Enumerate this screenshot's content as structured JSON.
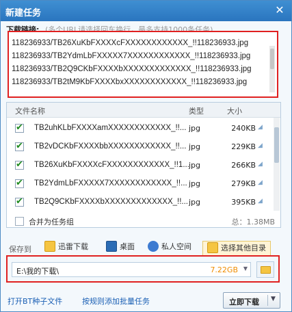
{
  "window": {
    "title": "新建任务",
    "close_icon": "close-icon"
  },
  "download_link": {
    "label": "下载链接:",
    "hint": "(多个URL请选择回车换行，最多支持1000条任务)",
    "urls": [
      "118236933/TB26XuKbFXXXXcFXXXXXXXXXXXX_!!118236933.jpg",
      "118236933/TB2YdmLbFXXXXX7XXXXXXXXXXXX_!!118236933.jpg",
      "118236933/TB2Q9CKbFXXXXbXXXXXXXXXXXXX_!!118236933.jpg",
      "118236933/TB2tM9KbFXXXXbxXXXXXXXXXXXX_!!118236933.jpg"
    ]
  },
  "file_list": {
    "columns": {
      "name": "文件名称",
      "type": "类型",
      "size": "大小"
    },
    "rows": [
      {
        "name": "TB2uhKLbFXXXXamXXXXXXXXXXXX_!!...",
        "type": "jpg",
        "size": "240KB"
      },
      {
        "name": "TB2vDCKbFXXXXbbXXXXXXXXXXXX_!!...",
        "type": "jpg",
        "size": "229KB"
      },
      {
        "name": "TB26XuKbFXXXXcFXXXXXXXXXXXX_!!1...",
        "type": "jpg",
        "size": "266KB"
      },
      {
        "name": "TB2YdmLbFXXXXX7XXXXXXXXXXXX_!!...",
        "type": "jpg",
        "size": "279KB"
      },
      {
        "name": "TB2Q9CKbFXXXXbXXXXXXXXXXXXX_!!...",
        "type": "jpg",
        "size": "395KB"
      }
    ],
    "merge_label": "合并为任务组",
    "total": "总：1.38MB"
  },
  "save_to": {
    "label": "保存到",
    "locations": [
      {
        "label": "迅雷下载",
        "icon": "thunder-folder-icon",
        "color": "#f5c542"
      },
      {
        "label": "桌面",
        "icon": "desktop-icon",
        "color": "#2b6cb5"
      },
      {
        "label": "私人空间",
        "icon": "private-space-icon",
        "color": "#3d7bd1"
      },
      {
        "label": "选择其他目录",
        "icon": "folder-icon",
        "color": "#f5c542"
      }
    ],
    "path": "E:\\我的下载\\",
    "free_space": "7.22GB"
  },
  "footer": {
    "open_bt": "打开BT种子文件",
    "batch_add": "按规则添加批量任务",
    "download_now": "立即下载"
  },
  "colors": {
    "titlebar": "#2f80cc",
    "highlight_border": "#e02020",
    "link": "#1a5fb4",
    "free_space": "#f08c00"
  }
}
